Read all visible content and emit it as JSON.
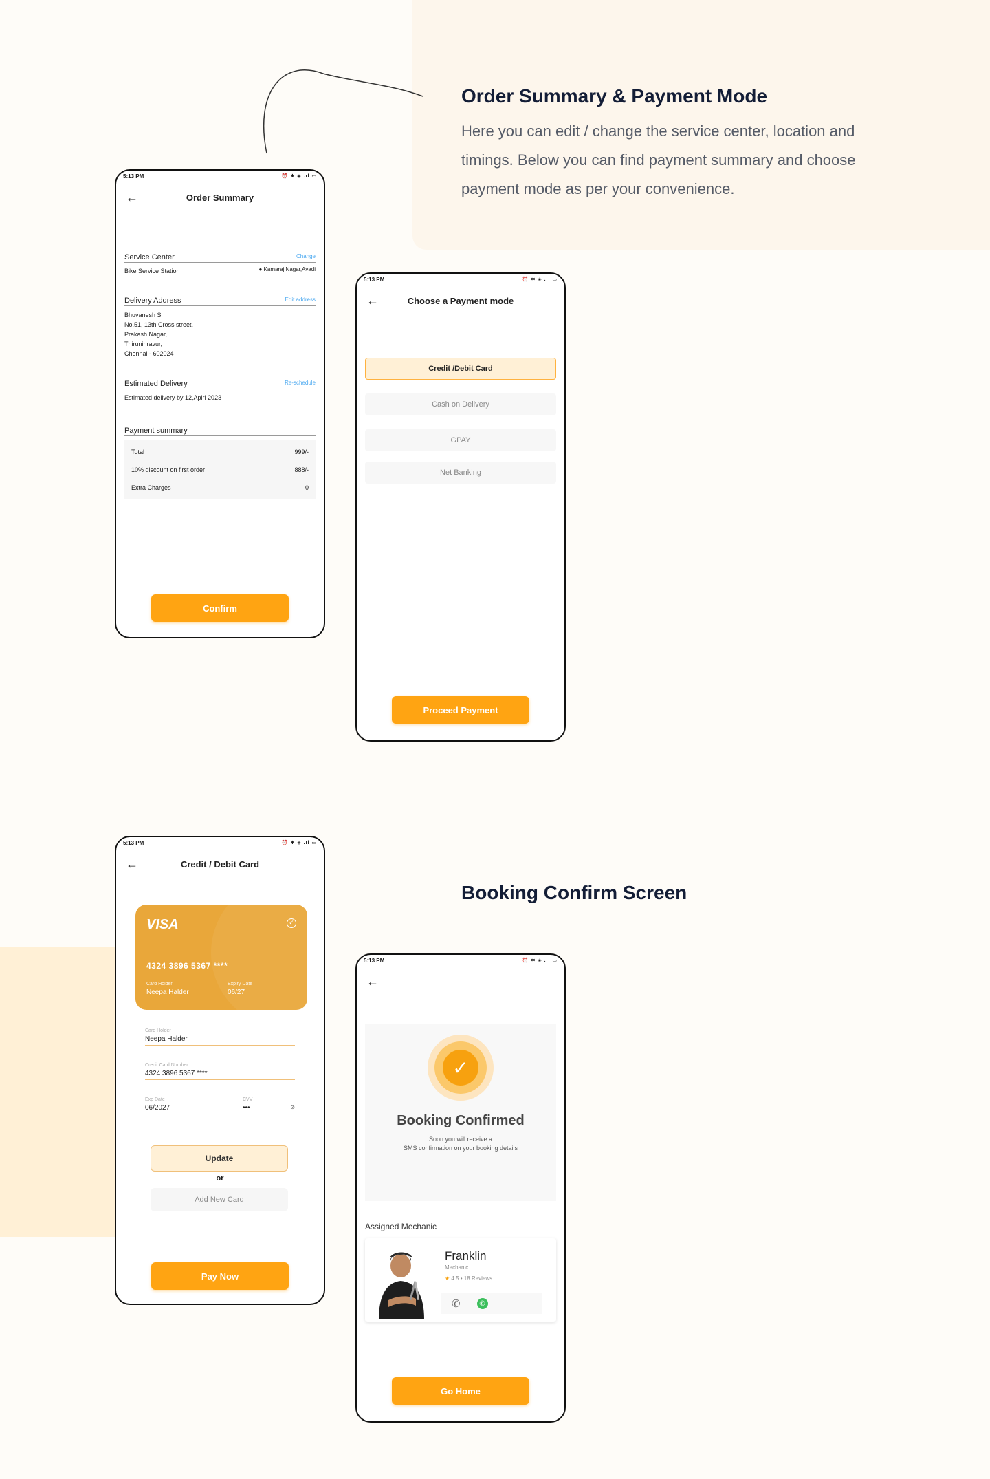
{
  "section1": {
    "title": "Order Summary & Payment Mode",
    "description": "Here you can edit / change the service center, location and timings. Below you can find payment summary and choose payment mode as per your convenience."
  },
  "section2": {
    "title": "Booking Confirm Screen"
  },
  "status_bar": {
    "time": "5:13 PM",
    "icons": "⏰ ✱ ◈ .ıl ▭"
  },
  "order_summary": {
    "title": "Order Summary",
    "service_center": {
      "heading": "Service Center",
      "link": "Change",
      "name": "Bike Service Station",
      "location": "Kamaraj Nagar,Avadi"
    },
    "delivery_address": {
      "heading": "Delivery Address",
      "link": "Edit address",
      "lines": [
        "Bhuvanesh S",
        "No.51, 13th Cross street,",
        "Prakash Nagar,",
        "Thiruninravur,",
        "Chennai - 602024"
      ]
    },
    "estimated_delivery": {
      "heading": "Estimated Delivery",
      "link": "Re-schedule",
      "text": "Estimated delivery by 12,Apirl 2023"
    },
    "payment_summary": {
      "heading": "Payment summary",
      "rows": [
        {
          "label": "Total",
          "value": "999/-"
        },
        {
          "label": "10% discount on first order",
          "value": "888/-"
        },
        {
          "label": "Extra Charges",
          "value": "0"
        }
      ]
    },
    "confirm_label": "Confirm"
  },
  "payment_mode": {
    "title": "Choose a Payment mode",
    "options": [
      "Credit /Debit Card",
      "Cash on Delivery",
      "GPAY",
      "Net Banking"
    ],
    "selected": "Credit /Debit Card",
    "proceed_label": "Proceed Payment"
  },
  "card_screen": {
    "title": "Credit / Debit Card",
    "card": {
      "brand": "VISA",
      "number": "4324 3896 5367 ****",
      "holder_label": "Card Holder",
      "holder": "Neepa Halder",
      "expiry_label": "Expiry Date",
      "expiry": "06/27"
    },
    "fields": {
      "holder_label": "Card Holder",
      "holder_value": "Neepa Halder",
      "number_label": "Credit Card Number",
      "number_value": "4324 3896 5367 ****",
      "exp_label": "Exp Date",
      "exp_value": "06/2027",
      "cvv_label": "CVV",
      "cvv_value": "•••"
    },
    "update_label": "Update",
    "or_label": "or",
    "add_card_label": "Add New Card",
    "pay_label": "Pay Now"
  },
  "booking": {
    "title": "Booking Confirmed",
    "sub_line1": "Soon you will receive a",
    "sub_line2": "SMS confirmation on your booking details",
    "mechanic_label": "Assigned Mechanic",
    "mechanic": {
      "name": "Franklin",
      "role": "Mechanic",
      "rating": "4.5",
      "reviews": "18 Reviews"
    },
    "home_label": "Go Home"
  },
  "colors": {
    "accent": "#ffa412",
    "card": "#e9a73a",
    "panel": "#fdf6ec",
    "link": "#4aa8f0"
  }
}
